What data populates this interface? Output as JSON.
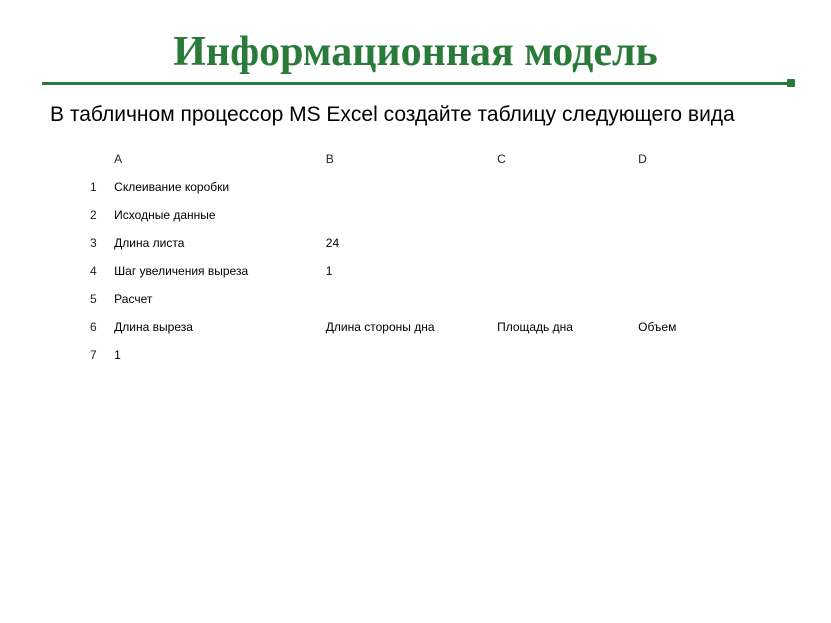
{
  "title": "Информационная модель",
  "subtitle": "В табличном процессор MS Excel создайте таблицу следующего вида",
  "columns": [
    "A",
    "B",
    "C",
    "D"
  ],
  "rows": {
    "r1": {
      "num": "1",
      "a": "Склеивание коробки"
    },
    "r2": {
      "num": "2",
      "a": "Исходные данные"
    },
    "r3": {
      "num": "3",
      "a": "Длина листа",
      "b": "24"
    },
    "r4": {
      "num": "4",
      "a": "Шаг увеличения выреза",
      "b": "1"
    },
    "r5": {
      "num": "5",
      "a": "Расчет"
    },
    "r6": {
      "num": "6",
      "a": "Длина выреза",
      "b": "Длина стороны дна",
      "c": "Площадь дна",
      "d": "Объем"
    },
    "r7": {
      "num": "7",
      "a": "1"
    }
  }
}
